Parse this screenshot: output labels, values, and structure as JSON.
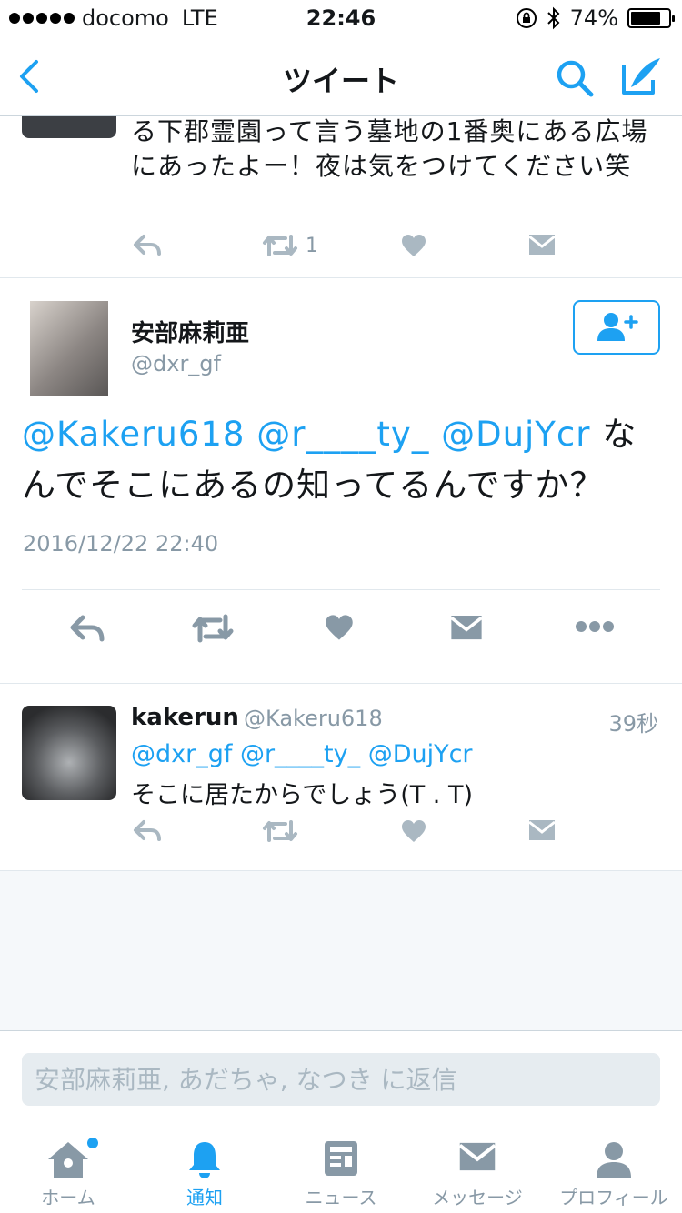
{
  "status_bar": {
    "carrier": "docomo",
    "network": "LTE",
    "time": "22:46",
    "battery": "74%",
    "battery_level": 0.74
  },
  "nav": {
    "title": "ツイート",
    "back_icon": "chevron-left-icon",
    "search_icon": "search-icon",
    "compose_icon": "compose-icon"
  },
  "previous_tweet": {
    "text": "る下郡霊園って言う墓地の1番奥にある広場にあったよー！夜は気をつけてください笑",
    "retweet_count": "1"
  },
  "main_tweet": {
    "name": "安部麻莉亜",
    "handle": "@dxr_gf",
    "mentions": "@Kakeru618 @r____ty_ @DujYcr",
    "text_after_mentions": " なんでそこにあるの知ってるんですか？",
    "timestamp": "2016/12/22 22:40"
  },
  "reply_tweet": {
    "name": "kakerun",
    "handle": "@Kakeru618",
    "time": "39秒",
    "mentions": "@dxr_gf @r____ty_ @DujYcr",
    "text": "そこに居たからでしょう(T . T)"
  },
  "reply_box": {
    "placeholder": "安部麻莉亜, あだちゃ, なつき に返信"
  },
  "tabs": [
    {
      "label": "ホーム",
      "icon": "home-icon"
    },
    {
      "label": "通知",
      "icon": "bell-icon"
    },
    {
      "label": "ニュース",
      "icon": "news-icon"
    },
    {
      "label": "メッセージ",
      "icon": "envelope-icon"
    },
    {
      "label": "プロフィール",
      "icon": "profile-icon"
    }
  ],
  "colors": {
    "accent": "#1da1f2",
    "muted": "#8899a6",
    "text": "#14171a"
  }
}
